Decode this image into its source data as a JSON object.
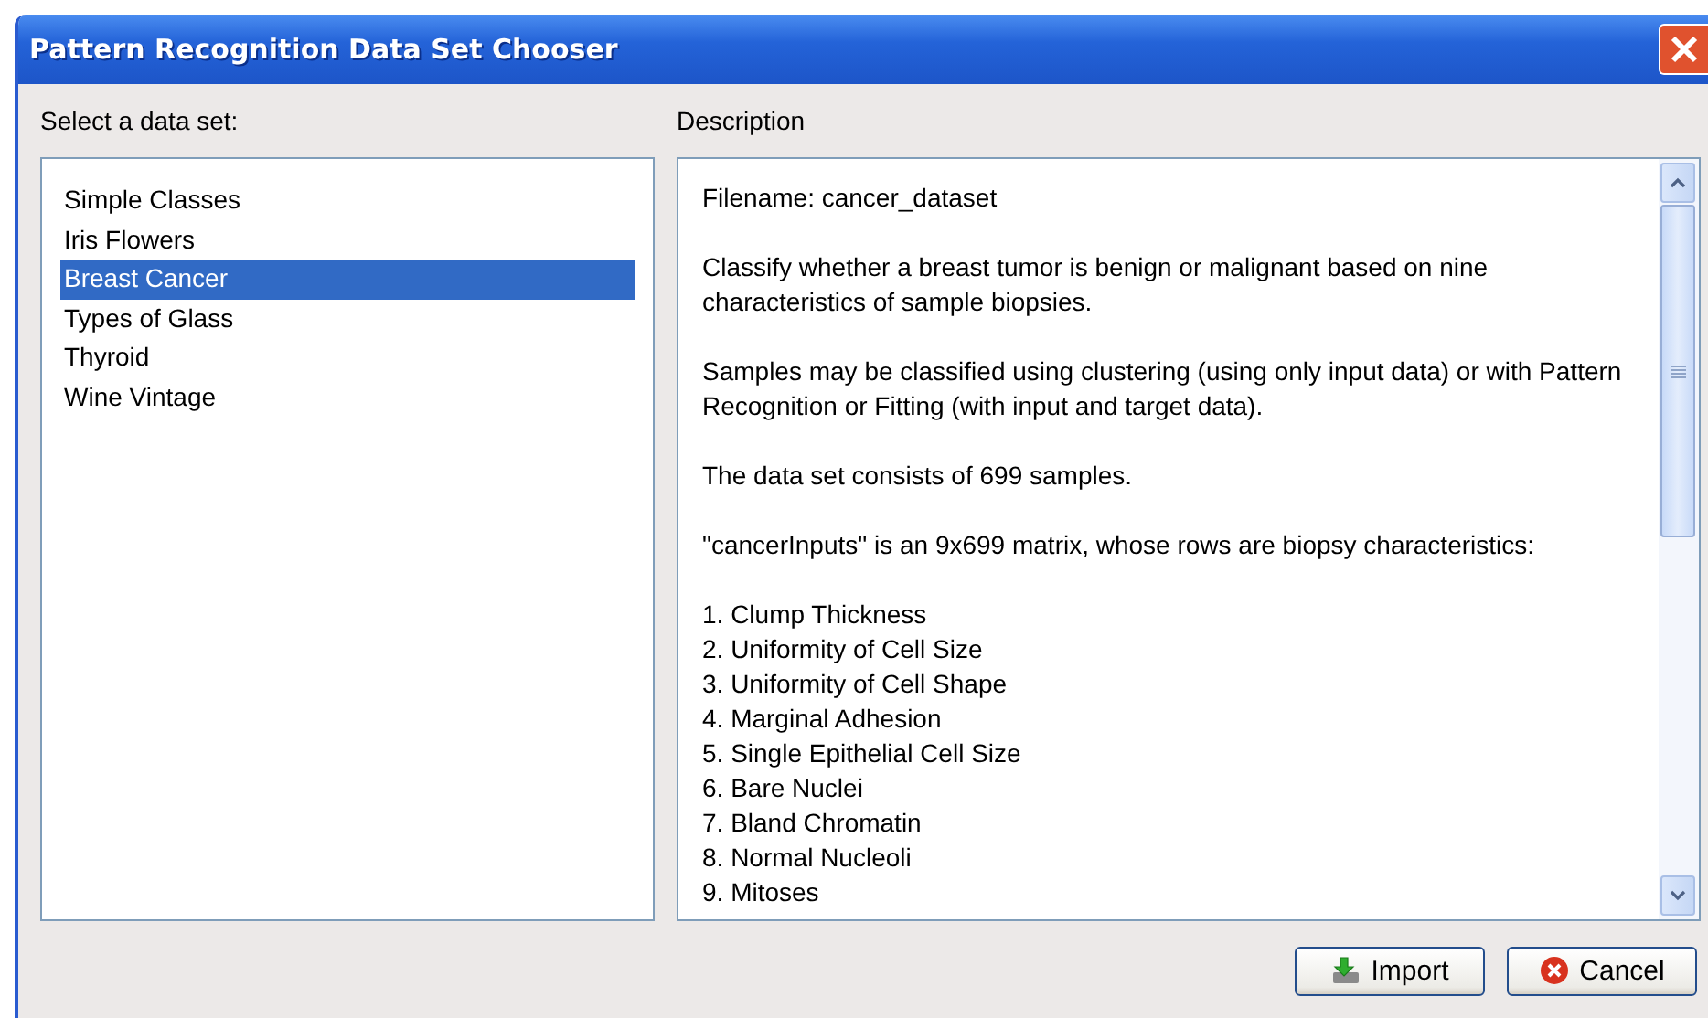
{
  "window": {
    "title": "Pattern Recognition Data Set Chooser"
  },
  "data_sets": {
    "label": "Select a data set:",
    "items": [
      {
        "name": "Simple Classes",
        "selected": false
      },
      {
        "name": "Iris Flowers",
        "selected": false
      },
      {
        "name": "Breast Cancer",
        "selected": true
      },
      {
        "name": "Types of Glass",
        "selected": false
      },
      {
        "name": "Thyroid",
        "selected": false
      },
      {
        "name": "Wine Vintage",
        "selected": false
      }
    ]
  },
  "description": {
    "label": "Description",
    "blocks": [
      {
        "kind": "paragraph",
        "text": "Filename: cancer_dataset"
      },
      {
        "kind": "paragraph",
        "text": "Classify whether a breast tumor is benign or malignant based on nine characteristics of sample biopsies."
      },
      {
        "kind": "paragraph",
        "text": "Samples may be classified using clustering (using only input data) or with Pattern Recognition or Fitting (with input and target data)."
      },
      {
        "kind": "paragraph",
        "text": "The data set consists of 699 samples."
      },
      {
        "kind": "paragraph",
        "text": "\"cancerInputs\" is an 9x699 matrix, whose rows are biopsy characteristics:"
      },
      {
        "kind": "list",
        "items": [
          "1. Clump Thickness",
          "2. Uniformity of Cell Size",
          "3. Uniformity of Cell Shape",
          "4. Marginal Adhesion",
          "5. Single Epithelial Cell Size",
          "6. Bare Nuclei",
          "7. Bland Chromatin",
          "8. Normal Nucleoli",
          "9. Mitoses"
        ]
      }
    ]
  },
  "buttons": [
    {
      "kind": "import",
      "label": "Import"
    },
    {
      "kind": "cancel",
      "label": "Cancel"
    }
  ]
}
